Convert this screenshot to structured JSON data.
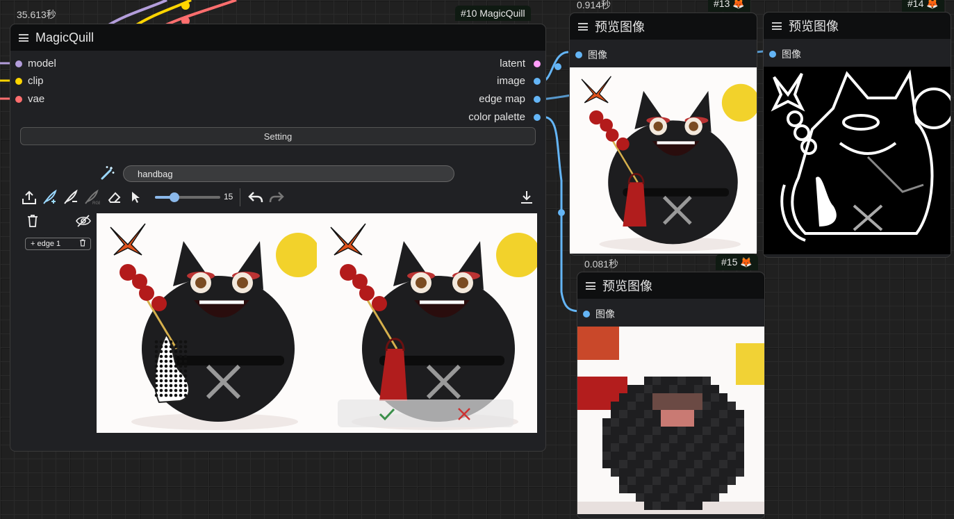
{
  "main_node": {
    "timer": "35.613秒",
    "badge": "#10 MagicQuill",
    "title": "MagicQuill",
    "inputs": [
      {
        "label": "model",
        "color": "#b39ddb"
      },
      {
        "label": "clip",
        "color": "#ffd500"
      },
      {
        "label": "vae",
        "color": "#ff6e6e"
      }
    ],
    "outputs": [
      {
        "label": "latent",
        "color": "#ff9cf9"
      },
      {
        "label": "image",
        "color": "#64b5f6"
      },
      {
        "label": "edge map",
        "color": "#64b5f6"
      },
      {
        "label": "color palette",
        "color": "#64b5f6"
      }
    ],
    "setting_label": "Setting",
    "prompt_value": "handbag",
    "brush_size": "15",
    "brush_size_fraction": 0.3,
    "edge_chip_label": "+ edge 1",
    "icons": {
      "wand": "magic-wand-icon",
      "upload": "upload-icon",
      "add_brush": "add-brush-icon",
      "subtract_brush": "subtract-brush-icon",
      "color_brush": "color-brush-icon",
      "eraser": "eraser-icon",
      "pointer": "pointer-icon",
      "undo": "undo-icon",
      "redo": "redo-icon",
      "download": "download-icon",
      "trash": "trash-icon",
      "hide": "eye-off-icon",
      "accept": "check-icon",
      "reject": "x-icon"
    }
  },
  "preview_13": {
    "timer": "0.914秒",
    "badge": "#13 🦊",
    "title": "预览图像",
    "input_label": "图像"
  },
  "preview_14": {
    "badge": "#14 🦊",
    "title": "预览图像",
    "input_label": "图像"
  },
  "preview_15": {
    "timer": "0.081秒",
    "badge": "#15 🦊",
    "title": "预览图像",
    "input_label": "图像"
  }
}
